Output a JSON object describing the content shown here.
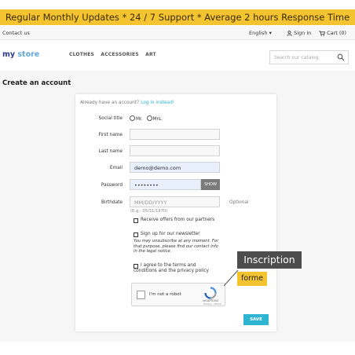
{
  "banner": {
    "text": "Regular Monthly Updates  *  24 / 7 Support  *  Average 2 hours Response Time"
  },
  "topbar": {
    "contact": "Contact us",
    "language": "English",
    "signin": "Sign in",
    "cart": "Cart (0)"
  },
  "header": {
    "logo_part1": "my",
    "logo_part2": " store",
    "menu": [
      "CLOTHES",
      "ACCESSORIES",
      "ART"
    ],
    "search_placeholder": "Search our catalog"
  },
  "page": {
    "title": "Create an account"
  },
  "form": {
    "already": "Already have an account?",
    "login_link": "Log in instead!",
    "social_title_label": "Social title",
    "social_options": [
      "Mr.",
      "Mrs."
    ],
    "first_name_label": "First name",
    "last_name_label": "Last name",
    "email_label": "Email",
    "email_value": "demo@demo.com",
    "password_label": "Password",
    "password_value": "••••••••",
    "show_label": "SHOW",
    "birthdate_label": "Birthdate",
    "birthdate_placeholder": "MM/DD/YYYY",
    "birthdate_hint": "(E.g.: 05/31/1970)",
    "optional": "Optional",
    "offers_label": "Receive offers from our partners",
    "newsletter_label": "Sign up for our newsletter",
    "newsletter_note": "You may unsubscribe at any moment. For that purpose, please find our contact info in the legal notice.",
    "terms_label": "I agree to the terms and conditions and the privacy policy",
    "captcha_text": "I'm not a robot",
    "captcha_brand": "reCAPTCHA",
    "captcha_links": "Privacy - Terms",
    "save_label": "SAVE"
  },
  "callouts": {
    "line1": "Inscription",
    "line2": "forme"
  },
  "colors": {
    "banner": "#f4c430",
    "accent": "#2fb5d2",
    "callout_dark": "#4d4d4d"
  }
}
